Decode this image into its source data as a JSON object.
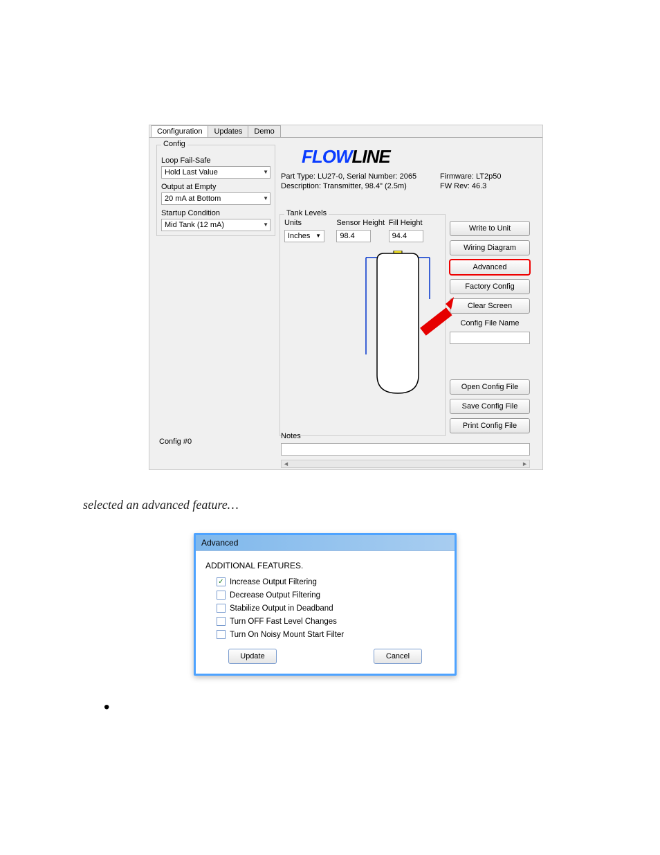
{
  "tabs": {
    "configuration": "Configuration",
    "updates": "Updates",
    "demo": "Demo"
  },
  "config_group": {
    "legend": "Config",
    "loop_fail_safe_label": "Loop Fail-Safe",
    "loop_fail_safe_value": "Hold Last Value",
    "output_at_empty_label": "Output at Empty",
    "output_at_empty_value": "20 mA at Bottom",
    "startup_condition_label": "Startup Condition",
    "startup_condition_value": "Mid Tank (12 mA)"
  },
  "config_hash": "Config #0",
  "logo": {
    "half1": "FLOW",
    "half2": "LINE"
  },
  "meta": {
    "part_type": "Part Type: LU27-0, Serial Number: 2065",
    "firmware": "Firmware: LT2p50",
    "description": "Description: Transmitter, 98.4\" (2.5m)",
    "fw_rev": "FW Rev: 46.3"
  },
  "tank_levels": {
    "legend": "Tank Levels",
    "units_label": "Units",
    "sensor_height_label": "Sensor Height",
    "fill_height_label": "Fill Height",
    "units_value": "Inches",
    "sensor_height_value": "98.4",
    "fill_height_value": "94.4"
  },
  "buttons": {
    "write": "Write to Unit",
    "wiring": "Wiring Diagram",
    "advanced": "Advanced",
    "factory": "Factory Config",
    "clear": "Clear Screen",
    "file_name_label": "Config File Name",
    "open": "Open Config File",
    "save": "Save Config File",
    "print": "Print Config File"
  },
  "notes_label": "Notes",
  "caption": "selected an advanced feature…",
  "advanced_dialog": {
    "title": "Advanced",
    "heading": "ADDITIONAL FEATURES.",
    "items": [
      {
        "label": "Increase Output Filtering",
        "checked": true
      },
      {
        "label": "Decrease Output Filtering",
        "checked": false
      },
      {
        "label": "Stabilize Output in Deadband",
        "checked": false
      },
      {
        "label": "Turn OFF Fast Level Changes",
        "checked": false
      },
      {
        "label": "Turn On Noisy Mount Start Filter",
        "checked": false
      }
    ],
    "update": "Update",
    "cancel": "Cancel"
  },
  "bullet": "•"
}
